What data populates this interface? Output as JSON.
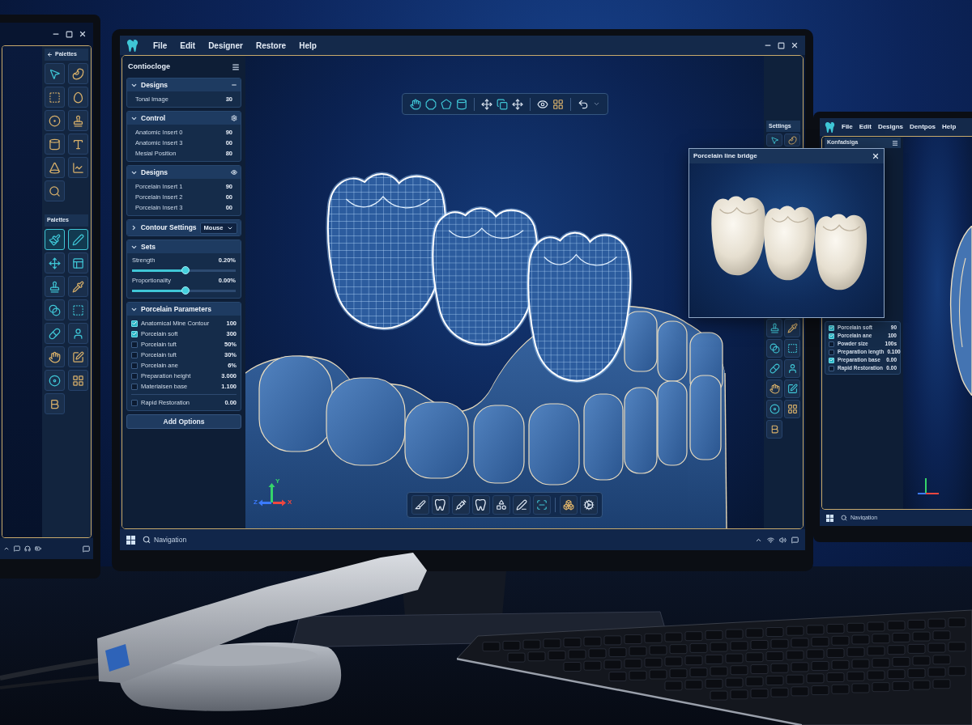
{
  "left_monitor": {
    "palettes": [
      {
        "title": "Palettes",
        "tools": [
          {
            "selected": false
          },
          {
            "selected": false
          },
          {
            "selected": false
          },
          {
            "selected": false
          },
          {
            "selected": false
          },
          {
            "selected": false
          },
          {
            "selected": false
          },
          {
            "selected": false
          },
          {
            "selected": false
          },
          {
            "selected": false
          },
          {
            "selected": false
          }
        ]
      },
      {
        "title": "Palettes",
        "tools": [
          {
            "selected": true
          },
          {
            "selected": true
          },
          {
            "selected": false
          },
          {
            "selected": false
          },
          {
            "selected": false
          },
          {
            "selected": false
          },
          {
            "selected": false
          },
          {
            "selected": false
          },
          {
            "selected": false
          },
          {
            "selected": false
          },
          {
            "selected": false
          },
          {
            "selected": false
          },
          {
            "selected": false
          },
          {
            "selected": false
          },
          {
            "selected": false
          }
        ]
      }
    ]
  },
  "main_monitor": {
    "menu": [
      "File",
      "Edit",
      "Designer",
      "Restore",
      "Help"
    ],
    "side_panel": {
      "title": "Contiocloge",
      "sections": [
        {
          "kind": "list",
          "title": "Designs",
          "expanded": true,
          "rows": [
            {
              "label": "Tonal Image",
              "value": "30"
            }
          ]
        },
        {
          "kind": "list",
          "title": "Control",
          "expanded": true,
          "rows": [
            {
              "label": "Anatomic Insert 0",
              "value": "90"
            },
            {
              "label": "Anatomic Insert 3",
              "value": "00"
            },
            {
              "label": "Mesial Position",
              "value": "80"
            }
          ]
        },
        {
          "kind": "list",
          "title": "Designs",
          "expanded": true,
          "rows": [
            {
              "label": "Porcelain Insert 1",
              "value": "90"
            },
            {
              "label": "Porcelain Insert 2",
              "value": "00"
            },
            {
              "label": "Porcelain Insert 3",
              "value": "00"
            }
          ]
        },
        {
          "kind": "dropdown",
          "title": "Contour Settings",
          "expanded": false,
          "value": "Mouse"
        },
        {
          "kind": "sliders",
          "title": "Sets",
          "expanded": true,
          "sliders": [
            {
              "label": "Strength",
              "reading": "0.20%",
              "level": 0.52
            },
            {
              "label": "Proportionality",
              "reading": "0.00%",
              "level": 0.52
            }
          ]
        },
        {
          "kind": "checklist",
          "title": "Porcelain Parameters",
          "expanded": true,
          "items": [
            {
              "label": "Anatomical Mine Contour",
              "value": "100",
              "checked": true
            },
            {
              "label": "Porcelain soft",
              "value": "300",
              "checked": true
            },
            {
              "label": "Porcelain tuft",
              "value": "50%",
              "checked": false
            },
            {
              "label": "Porcelain tuft",
              "value": "30%",
              "checked": false
            },
            {
              "label": "Porcelain ane",
              "value": "6%",
              "checked": false
            },
            {
              "label": "Preparation height",
              "value": "3.000",
              "checked": false
            },
            {
              "label": "Materialsen base",
              "value": "1.100",
              "checked": false
            }
          ],
          "footer_item": {
            "label": "Rapid Restoration",
            "value": "0.00",
            "checked": false
          }
        }
      ],
      "button": "Add Options"
    },
    "right_toolbar": {
      "title": "Settings"
    },
    "axes": [
      {
        "label": "Y",
        "color": "#35d46a"
      },
      {
        "label": "Z",
        "color": "#3b7bff"
      },
      {
        "label": "X",
        "color": "#f0473f"
      }
    ],
    "taskbar": {
      "search": {
        "placeholder": "Navigation"
      }
    }
  },
  "popup": {
    "title": "Porcelain line bridge"
  },
  "right_monitor": {
    "menu": [
      "File",
      "Edit",
      "Designs",
      "Dentpos",
      "Help"
    ],
    "panel": {
      "title": "Konfadsiga",
      "items": [
        {
          "label": "Porcelain soft",
          "value": "90",
          "checked": true
        },
        {
          "label": "Porcelain ane",
          "value": "100",
          "checked": true
        },
        {
          "label": "Powder size",
          "value": "100s",
          "checked": false
        },
        {
          "label": "Preparation length",
          "value": "0.100",
          "checked": false
        },
        {
          "label": "Preparation base",
          "value": "0.00",
          "checked": true
        },
        {
          "label": "Rapid Restoration",
          "value": "0.00",
          "checked": false
        }
      ]
    },
    "taskbar": {
      "search": {
        "placeholder": "Navigation"
      }
    }
  }
}
